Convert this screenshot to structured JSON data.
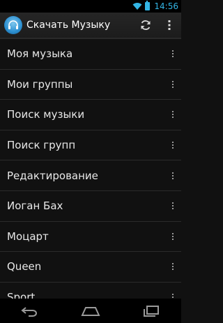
{
  "status_bar": {
    "time": "14:56",
    "icons": [
      "wifi-icon",
      "battery-icon"
    ],
    "accent_color": "#33b5e5"
  },
  "action_bar": {
    "title": "Скачать Музыку",
    "icons": [
      "app-headphones-icon",
      "refresh-icon",
      "overflow-menu-icon"
    ]
  },
  "list": {
    "items": [
      {
        "label": "Моя музыка"
      },
      {
        "label": "Мои группы"
      },
      {
        "label": "Поиск музыки"
      },
      {
        "label": "Поиск групп"
      },
      {
        "label": "Редактирование"
      },
      {
        "label": "Иоган Бах"
      },
      {
        "label": "Моцарт"
      },
      {
        "label": "Queen"
      },
      {
        "label": "Sport"
      }
    ]
  },
  "nav_bar": {
    "icons": [
      "back-icon",
      "home-icon",
      "recent-apps-icon"
    ]
  }
}
